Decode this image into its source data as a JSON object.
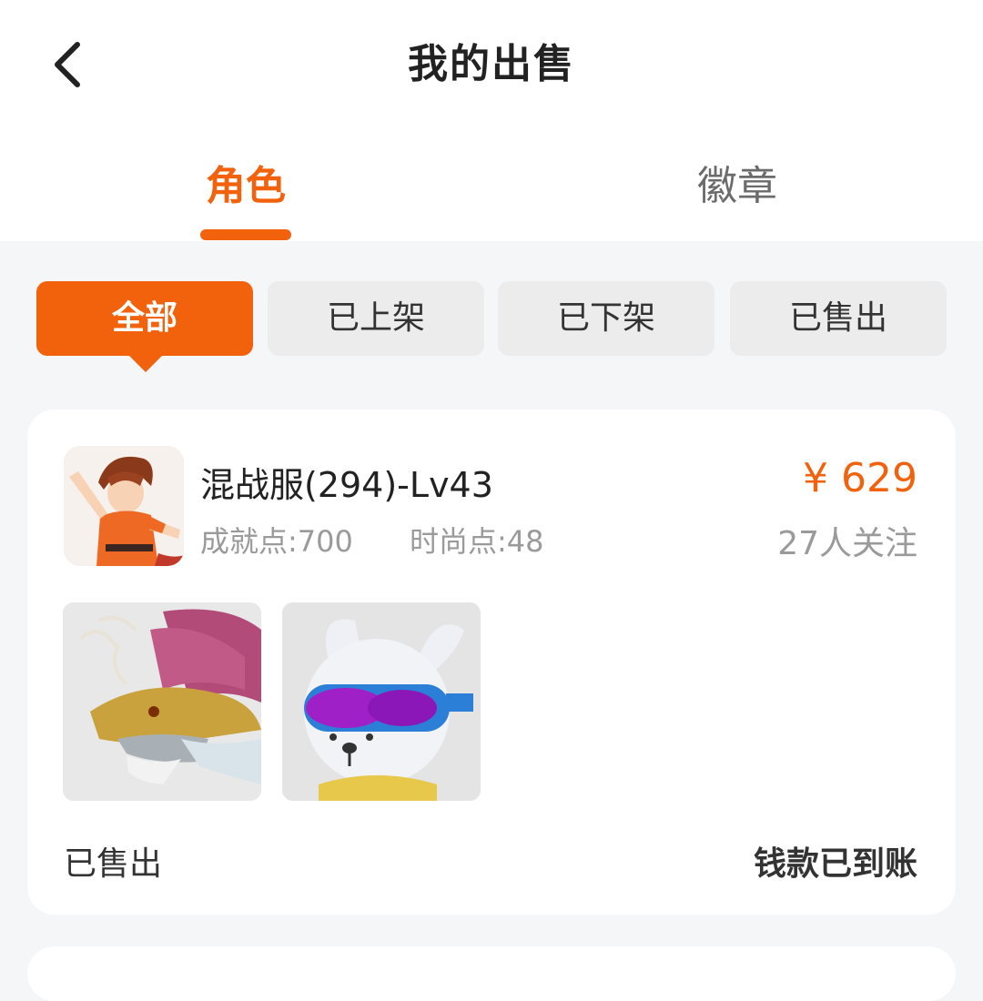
{
  "header": {
    "title": "我的出售",
    "back_icon": "chevron-left-icon"
  },
  "tabs": [
    {
      "label": "角色",
      "active": true
    },
    {
      "label": "徽章",
      "active": false
    }
  ],
  "filters": [
    {
      "label": "全部",
      "active": true
    },
    {
      "label": "已上架",
      "active": false
    },
    {
      "label": "已下架",
      "active": false
    },
    {
      "label": "已售出",
      "active": false
    }
  ],
  "listings": [
    {
      "name": "混战服(294)-Lv43",
      "achievement": "成就点:700",
      "fashion": "时尚点:48",
      "price": "¥ 629",
      "followers": "27人关注",
      "items": [
        "dragon-item-image",
        "dog-goggles-item-image"
      ],
      "status": "已售出",
      "payment_status": "钱款已到账"
    }
  ],
  "colors": {
    "accent": "#f2620d",
    "background": "#f5f6f8",
    "card": "#ffffff",
    "muted_text": "#9a9a9a"
  }
}
